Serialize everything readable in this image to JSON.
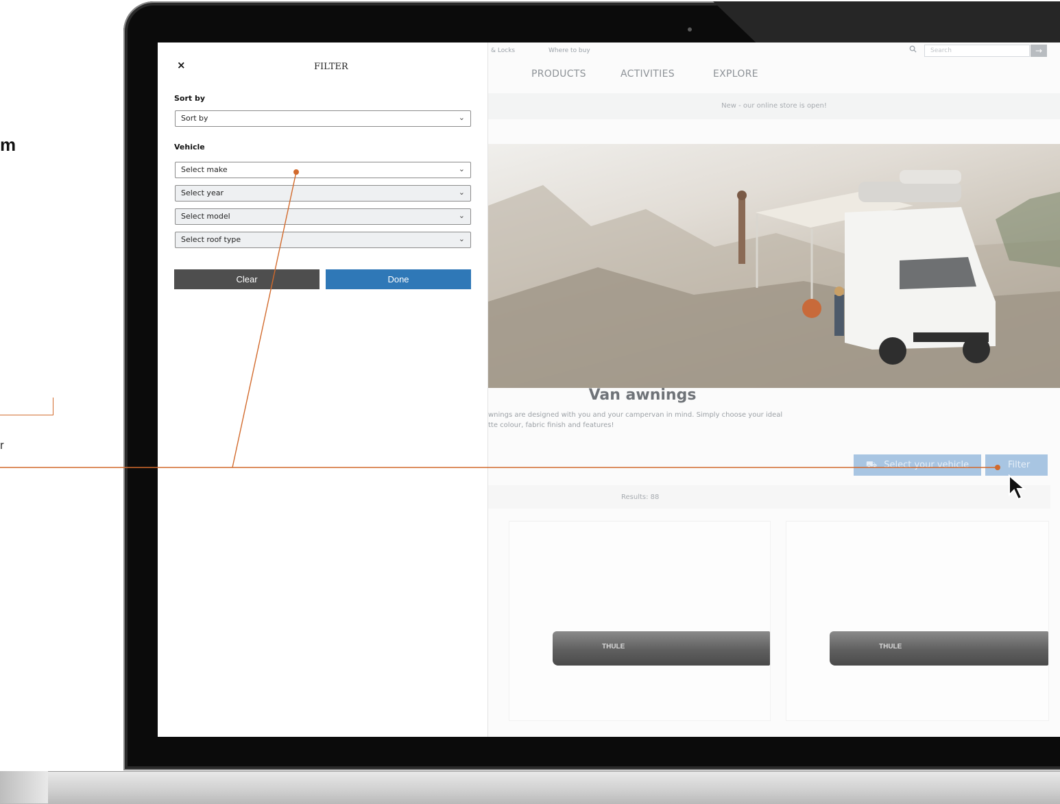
{
  "outer": {
    "heading_fragment": "m",
    "small_fragment": "r"
  },
  "site": {
    "topbar": {
      "link1": "& Locks",
      "link2": "Where to buy",
      "search_placeholder": "Search",
      "search_go": "→"
    },
    "nav": [
      "PRODUCTS",
      "ACTIVITIES",
      "EXPLORE"
    ],
    "banner": "New - our online store is open!",
    "page_title": "Van awnings",
    "description_line1": "wnings are designed with you and your campervan in mind. Simply choose your ideal",
    "description_line2": "tte colour, fabric finish and features!",
    "select_vehicle_label": "Select your vehicle",
    "filter_label": "Filter",
    "results": "Results: 88",
    "product_logo": "THULE"
  },
  "panel": {
    "close": "×",
    "title": "FILTER",
    "sort_label": "Sort by",
    "sort_value": "Sort by",
    "vehicle_label": "Vehicle",
    "selects": [
      "Select make",
      "Select year",
      "Select model",
      "Select roof type"
    ],
    "clear_label": "Clear",
    "done_label": "Done"
  },
  "colors": {
    "accent_annotation": "#d26a2c",
    "done_button": "#2f78b7",
    "clear_button": "#4e4e4e"
  }
}
